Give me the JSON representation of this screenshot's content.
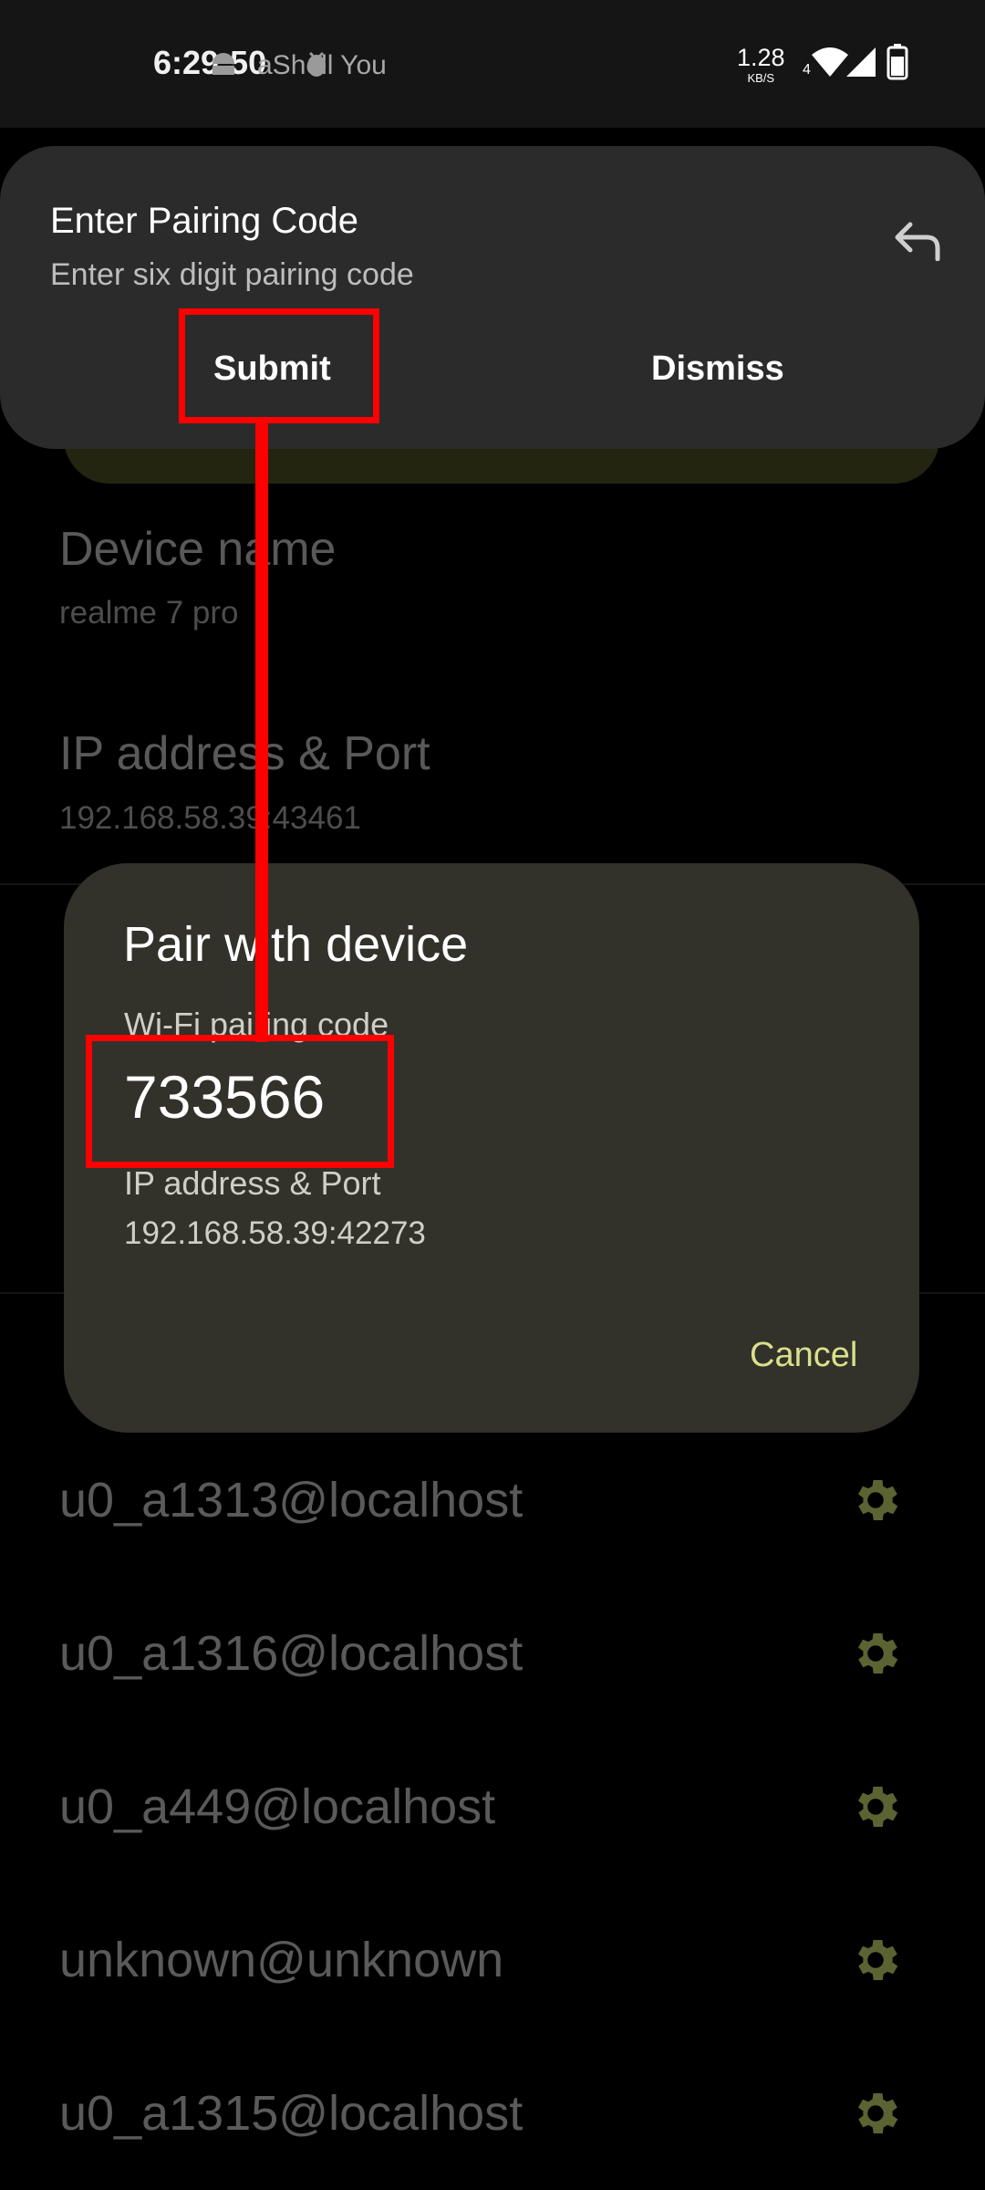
{
  "status_bar": {
    "time": "6:29:50",
    "app_label": "aShell You",
    "net_speed_value": "1.28",
    "net_speed_unit": "KB/S",
    "network_badge": "4",
    "icons": [
      "android-icon",
      "bug-icon",
      "wifi-icon",
      "signal-icon",
      "battery-icon"
    ]
  },
  "notification": {
    "title": "Enter Pairing Code",
    "subtitle": "Enter six digit pairing code",
    "submit_label": "Submit",
    "dismiss_label": "Dismiss",
    "reply_icon": "reply-icon"
  },
  "settings": {
    "device_name_title": "Device name",
    "device_name_value": "realme 7 pro",
    "ip_title": "IP address & Port",
    "ip_value": "192.168.58.39:43461"
  },
  "dialog": {
    "title": "Pair with device",
    "code_label": "Wi-Fi pairing code",
    "code": "733566",
    "ip_label": "IP address & Port",
    "ip_value": "192.168.58.39:42273",
    "cancel_label": "Cancel"
  },
  "connections": [
    {
      "label": "u0_a1313@localhost"
    },
    {
      "label": "u0_a1316@localhost"
    },
    {
      "label": "u0_a449@localhost"
    },
    {
      "label": "unknown@unknown"
    },
    {
      "label": "u0_a1315@localhost"
    }
  ],
  "colors": {
    "accent": "#dbe08a",
    "annotation": "#ff0000",
    "dialog_bg": "#32322b",
    "gear": "#5c6333"
  }
}
